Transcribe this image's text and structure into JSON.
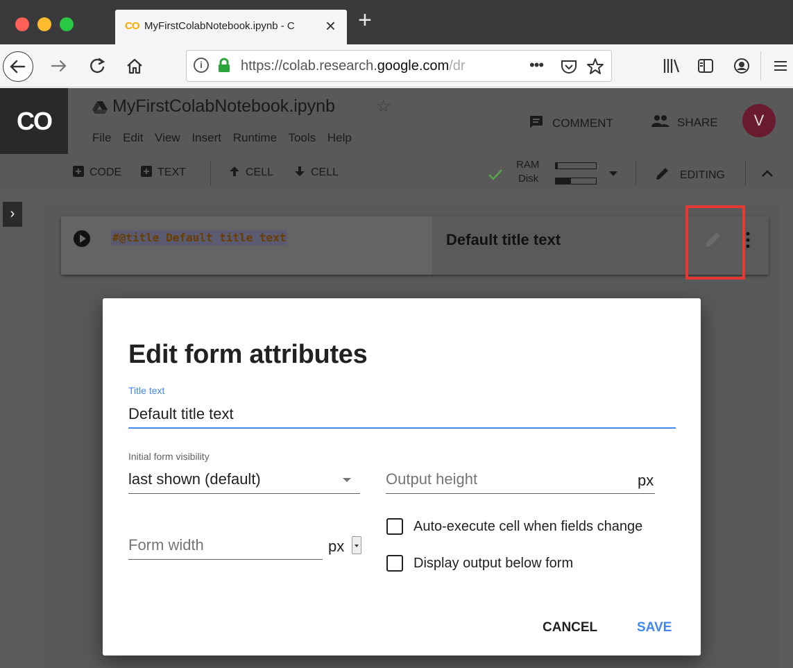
{
  "browser": {
    "tab_title": "MyFirstColabNotebook.ipynb - C",
    "tab_favicon": "CO",
    "url_prefix": "https://colab.research.",
    "url_domain": "google.com",
    "url_suffix": "/dr"
  },
  "colab": {
    "logo": "CO",
    "notebook_title": "MyFirstColabNotebook.ipynb",
    "menu": [
      "File",
      "Edit",
      "View",
      "Insert",
      "Runtime",
      "Tools",
      "Help"
    ],
    "comment_label": "COMMENT",
    "share_label": "SHARE",
    "avatar_initial": "V"
  },
  "toolbar": {
    "code_label": "CODE",
    "text_label": "TEXT",
    "cell_up_label": "CELL",
    "cell_down_label": "CELL",
    "ram_label": "RAM",
    "disk_label": "Disk",
    "ram_usage": 0.05,
    "disk_usage": 0.38,
    "editing_label": "EDITING"
  },
  "cell": {
    "code": "#@title Default title text",
    "form_title": "Default title text"
  },
  "dialog": {
    "title": "Edit form attributes",
    "title_text_label": "Title text",
    "title_text_value": "Default title text",
    "visibility_label": "Initial form visibility",
    "visibility_value": "last shown (default)",
    "output_height_placeholder": "Output height",
    "output_height_unit": "px",
    "form_width_placeholder": "Form width",
    "form_width_unit": "px",
    "auto_execute_label": "Auto-execute cell when fields change",
    "auto_execute_checked": false,
    "display_output_label": "Display output below form",
    "display_output_checked": false,
    "cancel_label": "CANCEL",
    "save_label": "SAVE"
  },
  "colors": {
    "accent": "#4285f4",
    "highlight": "#e53935",
    "avatar": "#6a1a2e"
  }
}
